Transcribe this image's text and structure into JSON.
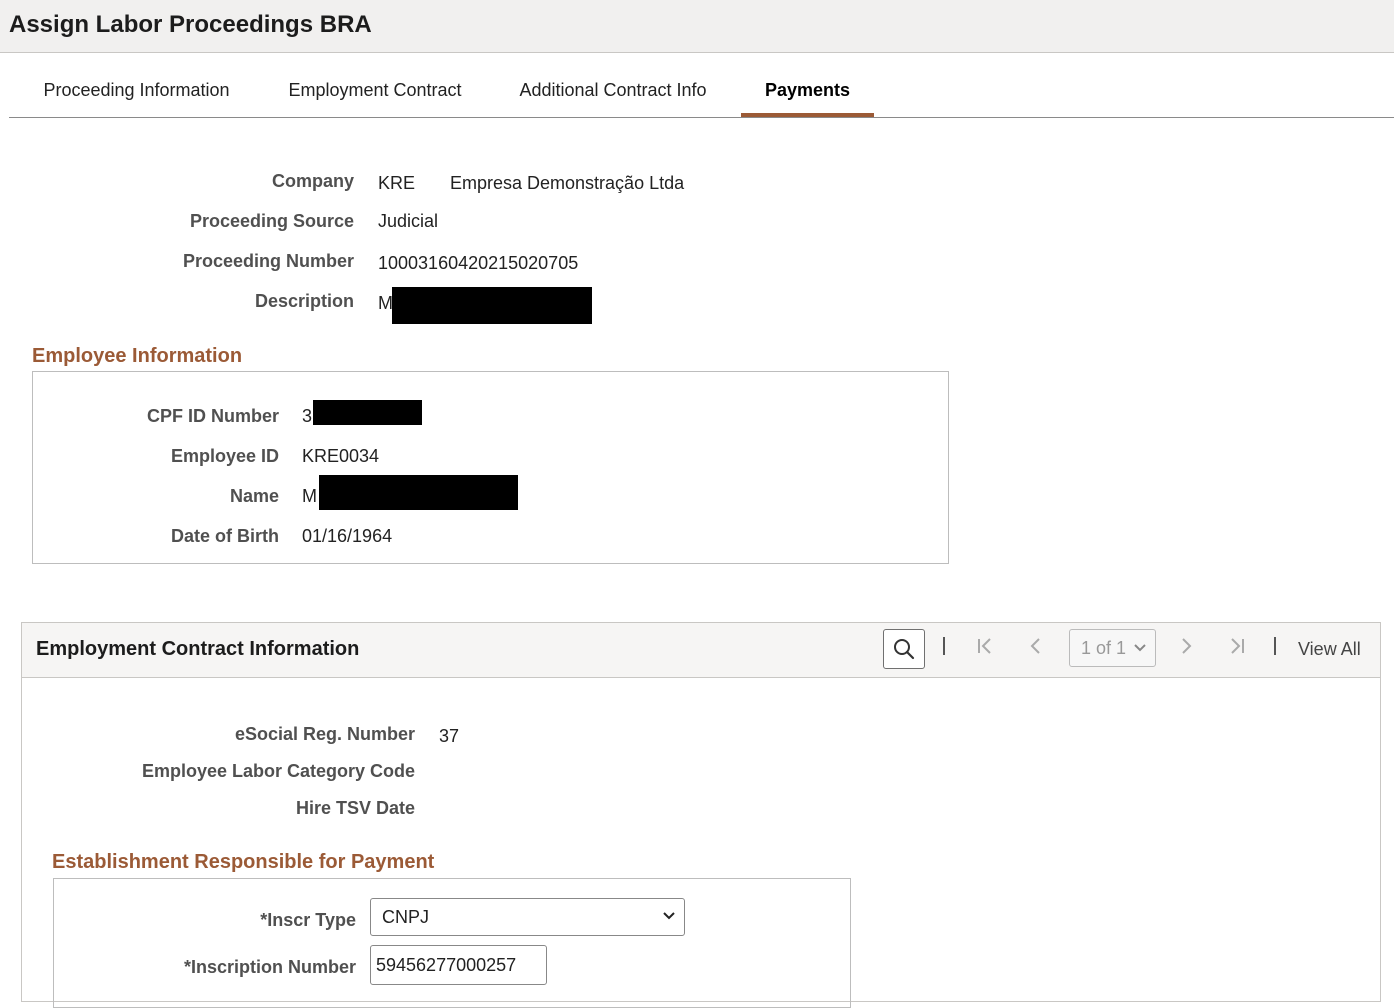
{
  "header": {
    "title": "Assign Labor Proceedings BRA"
  },
  "tabs": [
    {
      "label": "Proceeding Information",
      "active": false
    },
    {
      "label": "Employment Contract",
      "active": false
    },
    {
      "label": "Additional Contract Info",
      "active": false
    },
    {
      "label": "Payments",
      "active": true
    }
  ],
  "proceeding": {
    "company_label": "Company",
    "company_code": "KRE",
    "company_name": "Empresa Demonstração Ltda",
    "source_label": "Proceeding Source",
    "source_value": "Judicial",
    "number_label": "Proceeding Number",
    "number_value": "10003160420215020705",
    "description_label": "Description",
    "description_value": "M"
  },
  "employee": {
    "section_title": "Employee Information",
    "cpf_label": "CPF ID Number",
    "cpf_value": "3",
    "id_label": "Employee ID",
    "id_value": "KRE0034",
    "name_label": "Name",
    "name_value": "M",
    "dob_label": "Date of Birth",
    "dob_value": "01/16/1964"
  },
  "contract_grid": {
    "title": "Employment Contract Information",
    "pager_text": "1 of 1",
    "view_all": "View All",
    "esocial_label": "eSocial Reg. Number",
    "esocial_value": "37",
    "labor_cat_label": "Employee Labor Category Code",
    "hire_tsv_label": "Hire TSV Date"
  },
  "establishment": {
    "section_title": "Establishment Responsible for Payment",
    "inscr_type_label": "*Inscr Type",
    "inscr_type_value": "CNPJ",
    "inscr_number_label": "*Inscription Number",
    "inscr_number_value": "59456277000257"
  },
  "colors": {
    "accent": "#9b5a36",
    "title_bar": "#f1f0ef"
  },
  "icons": [
    "search-icon",
    "first-page-icon",
    "previous-page-icon",
    "next-page-icon",
    "last-page-icon",
    "chevron-down-icon"
  ]
}
